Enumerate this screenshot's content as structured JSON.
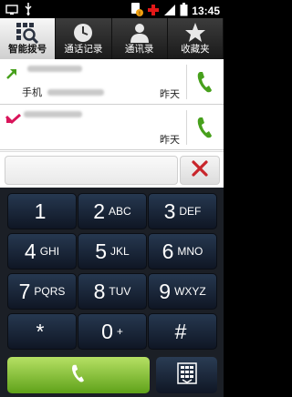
{
  "status_bar": {
    "time": "13:45",
    "icons": [
      "monitor-icon",
      "usb-icon",
      "sim-warning-icon",
      "cross-icon",
      "signal-icon",
      "battery-icon"
    ]
  },
  "tabs": [
    {
      "label": "智能拨号",
      "icon": "dialpad-search-icon",
      "active": true
    },
    {
      "label": "通话记录",
      "icon": "clock-icon",
      "active": false
    },
    {
      "label": "通讯录",
      "icon": "person-icon",
      "active": false
    },
    {
      "label": "收藏夹",
      "icon": "star-icon",
      "active": false
    }
  ],
  "call_log": [
    {
      "direction": "outgoing",
      "type_label": "手机",
      "date": "昨天"
    },
    {
      "direction": "missed",
      "type_label": "",
      "date": "昨天"
    }
  ],
  "keys": [
    {
      "digit": "1",
      "letters": ""
    },
    {
      "digit": "2",
      "letters": "ABC"
    },
    {
      "digit": "3",
      "letters": "DEF"
    },
    {
      "digit": "4",
      "letters": "GHI"
    },
    {
      "digit": "5",
      "letters": "JKL"
    },
    {
      "digit": "6",
      "letters": "MNO"
    },
    {
      "digit": "7",
      "letters": "PQRS"
    },
    {
      "digit": "8",
      "letters": "TUV"
    },
    {
      "digit": "9",
      "letters": "WXYZ"
    },
    {
      "digit": "*",
      "letters": ""
    },
    {
      "digit": "0",
      "letters": "+"
    },
    {
      "digit": "#",
      "letters": ""
    }
  ],
  "colors": {
    "accent_green": "#5fa21a",
    "missed_red": "#d9145a",
    "outgoing_green": "#47a01c",
    "delete_red": "#c8252b"
  }
}
